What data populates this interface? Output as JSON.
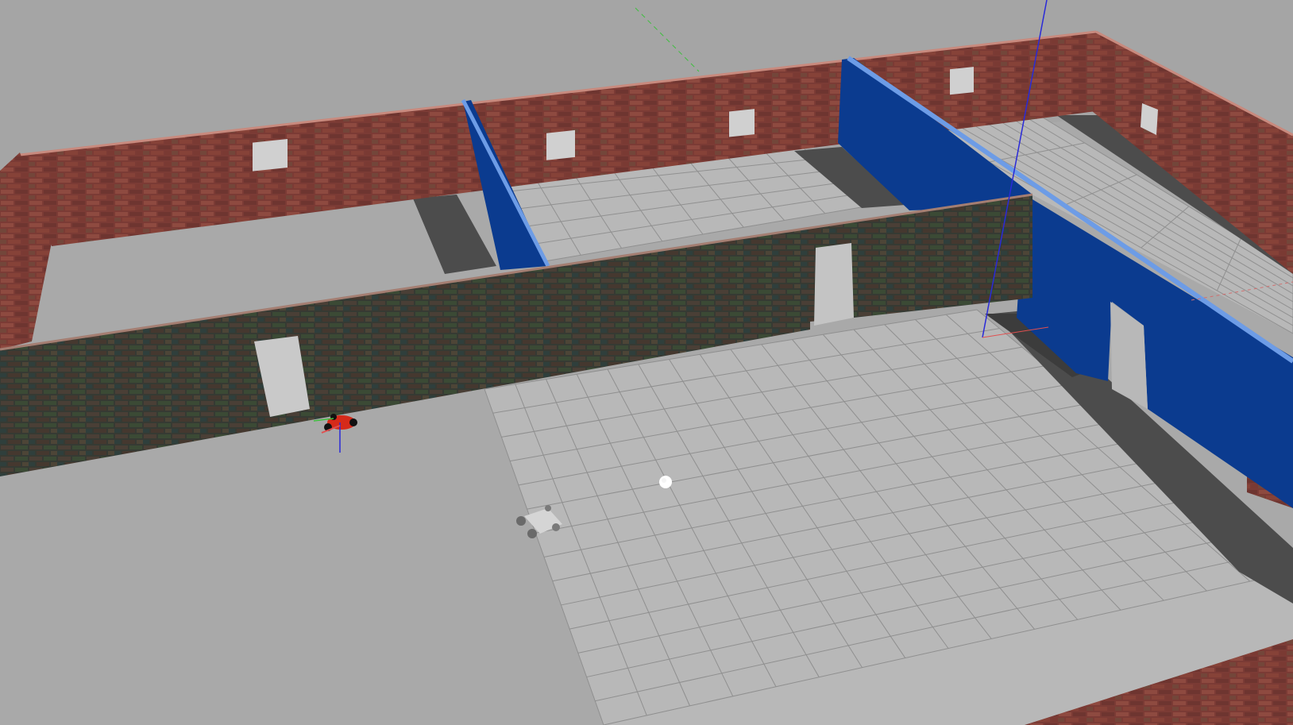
{
  "scene": {
    "colors": {
      "background": "#a5a5a5",
      "ground_tile": "#b6b6b6",
      "grid_line": "#8e8e8e",
      "shadow": "#4a4a4a",
      "brick_red": "#7e3e37",
      "brick_dark": "#3a3c34",
      "blue_wall": "#0a3a8c",
      "blue_edge": "#6d9ce6",
      "axis_x": "#e05050",
      "axis_y": "#3fbf3f",
      "axis_z": "#2a2ad8"
    },
    "icons": [
      "ground-plane",
      "brick-wall",
      "blue-partition",
      "robot-car",
      "ball",
      "mobile-robot",
      "axis-marker"
    ]
  }
}
